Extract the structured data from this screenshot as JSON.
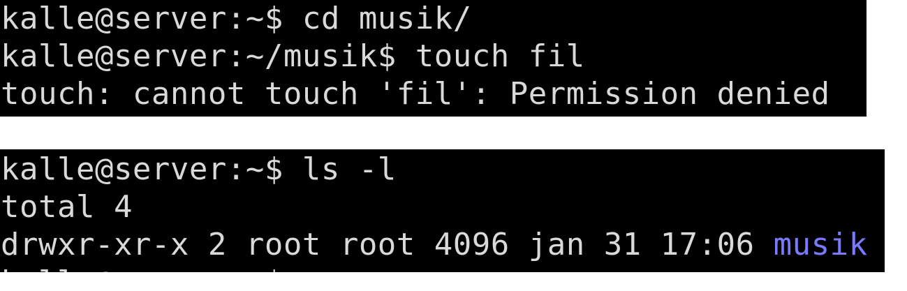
{
  "terminals": [
    {
      "lines": [
        "kalle@server:~$ cd musik/",
        "kalle@server:~/musik$ touch fil",
        "touch: cannot touch 'fil': Permission denied"
      ]
    },
    {
      "lines": [
        "kalle@server:~$ ls -l",
        "total 4"
      ],
      "listing": {
        "perms": "drwxr-xr-x 2 root root 4096 jan 31 17:06 ",
        "name": "musik"
      },
      "cut_line": "kalle@server:~$"
    }
  ],
  "colors": {
    "background": "#000000",
    "text": "#d9d9d9",
    "directory": "#7a7aff"
  }
}
